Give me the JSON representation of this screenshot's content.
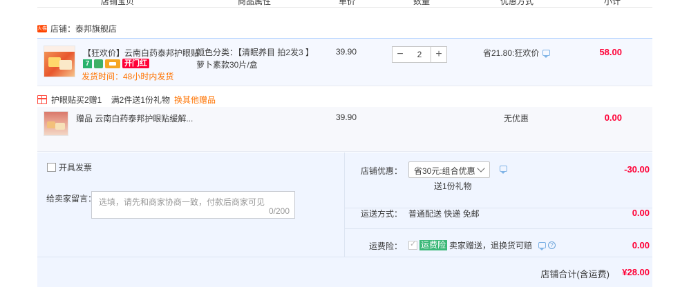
{
  "columns": {
    "item": "店铺宝贝",
    "props": "商品属性",
    "price": "单价",
    "qty": "数量",
    "promo": "优惠方式",
    "subtotal": "小计"
  },
  "shop": {
    "badge": "天猫",
    "label": "店铺：泰邦旗舰店"
  },
  "item1": {
    "title": "【狂欢价】云南白药泰邦护眼贴...",
    "tag_seven": "7",
    "tag_red": "开门红",
    "ship_time": "发货时间：48小时内发货",
    "prop_line1": "颜色分类：【清眠养目 拍2发3 】",
    "prop_line2": "萝卜素款30片/盒",
    "price": "39.90",
    "qty": "2",
    "qty_minus": "−",
    "qty_plus": "+",
    "promo": "省21.80:狂欢价",
    "subtotal": "58.00"
  },
  "gift_offer": {
    "text": "护眼贴买2赠1    满2件送1份礼物",
    "link": "换其他赠品"
  },
  "item2": {
    "title": "赠品  云南白药泰邦护眼贴缓解...",
    "price": "39.90",
    "promo": "无优惠",
    "subtotal": "0.00"
  },
  "footer": {
    "invoice_label": "开具发票",
    "message_label": "给卖家留言：",
    "message_placeholder": "选填，请先和商家协商一致，付款后商家可见",
    "message_count": "0/200",
    "shop_discount_label": "店铺优惠：",
    "shop_discount_value": "省30元:组合优惠",
    "shop_discount_note": "送1份礼物",
    "shop_discount_amount": "-30.00",
    "delivery_label": "运送方式：",
    "delivery_value": "普通配送 快递 免邮",
    "delivery_amount": "0.00",
    "insurance_label": "运费险：",
    "insurance_tag": "运费险",
    "insurance_text": "卖家赠送，退换货可赔",
    "insurance_amount": "0.00",
    "total_label": "店铺合计(含运费)",
    "total_value": "¥28.00"
  },
  "colors": {
    "accent_red": "#ff0036",
    "accent_orange": "#ff7300",
    "row_bg": "#f5f8ff",
    "footer_bg": "#f0f5ff"
  }
}
